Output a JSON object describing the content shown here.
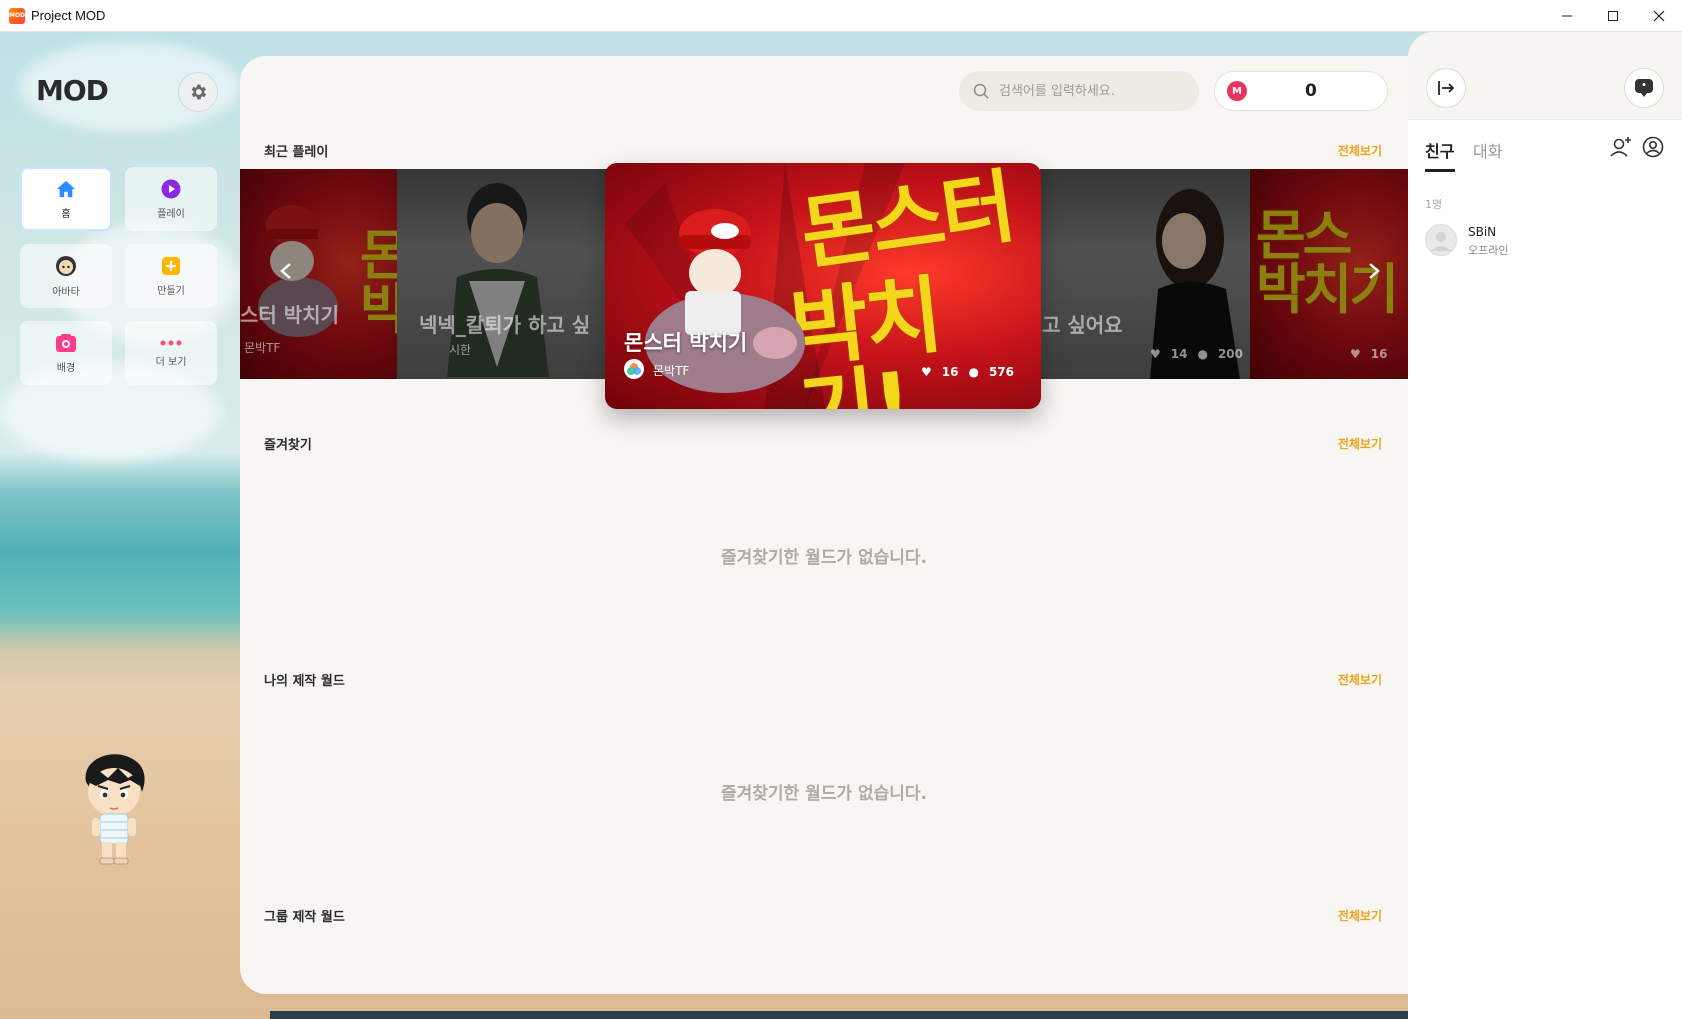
{
  "window": {
    "title": "Project MOD",
    "app_icon_text": "MOD"
  },
  "nav": {
    "logo": "MOD",
    "items": [
      {
        "label": "홈",
        "icon": "home-icon",
        "active": true
      },
      {
        "label": "플레이",
        "icon": "play-icon",
        "active": false
      },
      {
        "label": "아바타",
        "icon": "avatar-icon",
        "active": false
      },
      {
        "label": "만들기",
        "icon": "create-icon",
        "active": false
      },
      {
        "label": "배경",
        "icon": "background-icon",
        "active": false
      },
      {
        "label": "더 보기",
        "icon": "more-icon",
        "active": false
      }
    ]
  },
  "header": {
    "search_placeholder": "검색어를 입력하세요.",
    "coin_symbol": "M",
    "coin_value": "0"
  },
  "sections": {
    "recent": {
      "title": "최근 플레이",
      "see_all": "전체보기"
    },
    "favorites": {
      "title": "즐겨찾기",
      "see_all": "전체보기",
      "empty": "즐겨찾기한 월드가 없습니다."
    },
    "my_worlds": {
      "title": "나의 제작 월드",
      "see_all": "전체보기",
      "empty": "즐겨찾기한 월드가 없습니다."
    },
    "group_worlds": {
      "title": "그룹 제작 월드",
      "see_all": "전체보기"
    }
  },
  "carousel": {
    "featured": {
      "title": "몬스터 박치기",
      "author": "몬박TF",
      "likes": "16",
      "players": "576",
      "art_line1": "몬스터",
      "art_line2": "박치기!"
    },
    "left_far": {
      "title": "스터 박치기",
      "author": "몬박TF",
      "art": "몬 박"
    },
    "left_near": {
      "title": "넥넥_칼퇴가 하고 싶",
      "author": "시한"
    },
    "right_near": {
      "title": "고 싶어요",
      "likes": "14",
      "players": "200"
    },
    "right_far": {
      "art": "몬스 박치기",
      "likes": "16"
    }
  },
  "right_panel": {
    "tabs": [
      {
        "label": "친구",
        "active": true
      },
      {
        "label": "대화",
        "active": false
      }
    ],
    "friend_count": "1명",
    "friends": [
      {
        "name": "SBiN",
        "status": "오프라인"
      }
    ]
  }
}
